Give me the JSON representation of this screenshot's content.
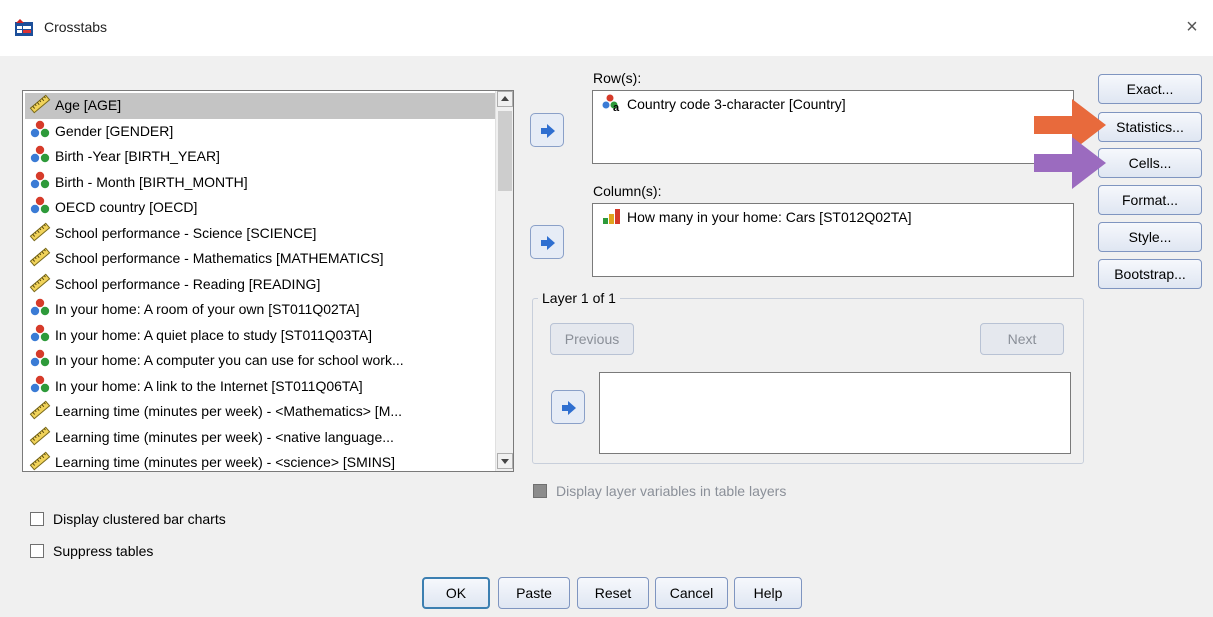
{
  "window": {
    "title": "Crosstabs",
    "close_glyph": "×"
  },
  "variables": [
    {
      "label": "Age [AGE]",
      "icon": "scale-ruler-icon",
      "selected": true
    },
    {
      "label": "Gender [GENDER]",
      "icon": "nominal-icon"
    },
    {
      "label": "Birth -Year [BIRTH_YEAR]",
      "icon": "nominal-icon"
    },
    {
      "label": "Birth - Month [BIRTH_MONTH]",
      "icon": "nominal-icon"
    },
    {
      "label": "OECD country [OECD]",
      "icon": "nominal-icon"
    },
    {
      "label": "School performance - Science [SCIENCE]",
      "icon": "scale-ruler-icon"
    },
    {
      "label": "School performance - Mathematics [MATHEMATICS]",
      "icon": "scale-ruler-icon"
    },
    {
      "label": "School performance - Reading [READING]",
      "icon": "scale-ruler-icon"
    },
    {
      "label": "In your home: A room of your own [ST011Q02TA]",
      "icon": "nominal-icon"
    },
    {
      "label": "In your home: A quiet place to study [ST011Q03TA]",
      "icon": "nominal-icon"
    },
    {
      "label": "In your home: A computer you can use for school work...",
      "icon": "nominal-icon"
    },
    {
      "label": "In your home: A link to the Internet [ST011Q06TA]",
      "icon": "nominal-icon"
    },
    {
      "label": "Learning time (minutes per week) - <Mathematics> [M...",
      "icon": "scale-ruler-icon"
    },
    {
      "label": "Learning time (minutes per week) - <native language...",
      "icon": "scale-ruler-icon"
    },
    {
      "label": "Learning time (minutes per week) - <science> [SMINS]",
      "icon": "scale-ruler-icon"
    }
  ],
  "rows": {
    "label": "Row(s):",
    "item": "Country code 3-character [Country]"
  },
  "columns": {
    "label": "Column(s):",
    "item": "How many in your home: Cars [ST012Q02TA]"
  },
  "layer": {
    "legend": "Layer 1 of 1",
    "previous": "Previous",
    "next": "Next"
  },
  "side_buttons": [
    "Exact...",
    "Statistics...",
    "Cells...",
    "Format...",
    "Style...",
    "Bootstrap..."
  ],
  "checkboxes": {
    "display_layer": "Display layer variables in table layers",
    "clustered_bar": "Display clustered bar charts",
    "suppress_tables": "Suppress tables"
  },
  "bottom_buttons": {
    "ok": "OK",
    "paste": "Paste",
    "reset": "Reset",
    "cancel": "Cancel",
    "help": "Help"
  },
  "colors": {
    "callout_orange": "#e86a3c",
    "callout_purple": "#9b6bbf",
    "arrow_blue": "#2f6fd0"
  }
}
